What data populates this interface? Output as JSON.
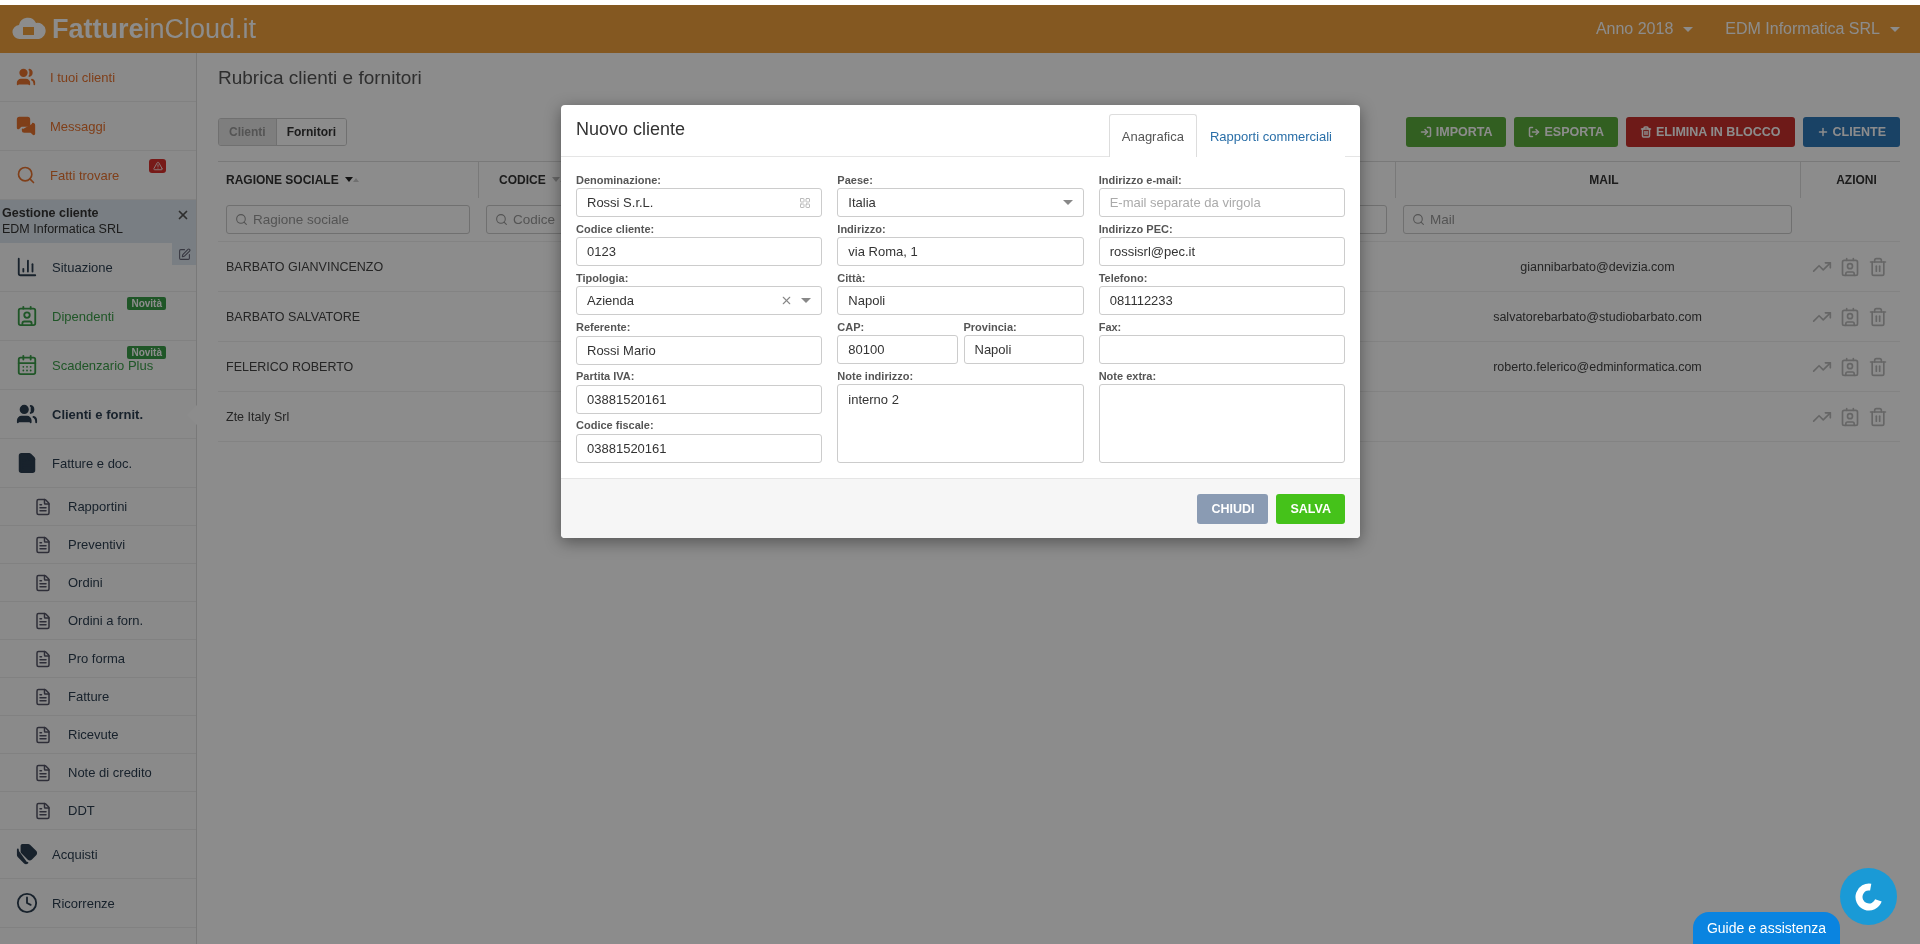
{
  "header": {
    "logo": "**Fatture**inCloud.it",
    "menus": [
      {
        "label": "Anno 2018"
      },
      {
        "label": "EDM Informatica SRL"
      }
    ]
  },
  "sidebar": {
    "top_items": [
      {
        "label": "I tuoi clienti",
        "alert": false
      },
      {
        "label": "Messaggi",
        "alert": false
      },
      {
        "label": "Fatti trovare",
        "alert": true
      }
    ],
    "client_section": {
      "title": "Gestione cliente",
      "client": "EDM Informatica SRL"
    },
    "items": [
      {
        "label": "Situazione",
        "selected": false
      },
      {
        "label": "Dipendenti",
        "badge": "Novità",
        "selected": false
      },
      {
        "label": "Scadenzario Plus",
        "badge": "Novità",
        "selected": false
      },
      {
        "label": "Clienti e fornit.",
        "selected": true
      },
      {
        "label": "Fatture e doc.",
        "selected": false,
        "children": [
          {
            "label": "Rapportini"
          },
          {
            "label": "Preventivi"
          },
          {
            "label": "Ordini"
          },
          {
            "label": "Ordini a forn."
          },
          {
            "label": "Pro forma"
          },
          {
            "label": "Fatture"
          },
          {
            "label": "Ricevute"
          },
          {
            "label": "Note di credito"
          },
          {
            "label": "DDT"
          }
        ]
      },
      {
        "label": "Acquisti",
        "selected": false
      },
      {
        "label": "Ricorrenze",
        "selected": false
      }
    ]
  },
  "main": {
    "title": "Rubrica clienti e fornitori",
    "tabs": [
      {
        "label": "Clienti",
        "selected": true
      },
      {
        "label": "Fornitori",
        "selected": false
      }
    ],
    "actions": [
      {
        "label": "IMPORTA",
        "kind": "import"
      },
      {
        "label": "ESPORTA",
        "kind": "export"
      },
      {
        "label": "ELIMINA IN BLOCCO",
        "kind": "delete"
      },
      {
        "label": "CLIENTE",
        "kind": "add"
      }
    ],
    "table": {
      "columns": [
        {
          "label": "RAGIONE SOCIALE",
          "sortable": true,
          "sorted": true,
          "filter": "Ragione sociale"
        },
        {
          "label": "CODICE",
          "sortable": true,
          "sorted": false,
          "filter": "Codice"
        },
        {
          "kind": "hidden"
        },
        {
          "label": "MAIL",
          "filter": "Mail"
        },
        {
          "label": "AZIONI"
        }
      ],
      "rows": [
        {
          "ragione_sociale": "BARBATO GIANVINCENZO",
          "mail": "giannibarbato@devizia.com"
        },
        {
          "ragione_sociale": "BARBATO SALVATORE",
          "mail": "salvatorebarbato@studiobarbato.com"
        },
        {
          "ragione_sociale": "FELERICO ROBERTO",
          "mail": "roberto.felerico@edminformatica.com"
        },
        {
          "ragione_sociale": "Zte Italy Srl"
        }
      ]
    }
  },
  "modal": {
    "title": "Nuovo cliente",
    "tabs": [
      {
        "label": "Anagrafica",
        "selected": true
      },
      {
        "label": "Rapporti commerciali",
        "selected": false
      }
    ],
    "columns": [
      [
        {
          "kind": "lookup",
          "label": "Denominazione:",
          "value": "Rossi S.r.L."
        },
        {
          "kind": "text",
          "label": "Codice cliente:",
          "value": "0123"
        },
        {
          "kind": "clearable_select",
          "label": "Tipologia:",
          "value": "Azienda"
        },
        {
          "kind": "text",
          "label": "Referente:",
          "value": "Rossi Mario"
        },
        {
          "kind": "text",
          "label": "Partita IVA:",
          "value": "03881520161"
        },
        {
          "kind": "text",
          "label": "Codice fiscale:",
          "value": "03881520161"
        }
      ],
      [
        {
          "kind": "select",
          "label": "Paese:",
          "value": "Italia"
        },
        {
          "kind": "text",
          "label": "Indirizzo:",
          "value": "via Roma, 1"
        },
        {
          "kind": "text",
          "label": "Città:",
          "value": "Napoli"
        },
        {
          "kind": "pair",
          "fields": [
            {
              "kind": "text",
              "label": "CAP:",
              "value": "80100"
            },
            {
              "kind": "text",
              "label": "Provincia:",
              "value": "Napoli"
            }
          ]
        },
        {
          "kind": "textarea",
          "label": "Note indirizzo:",
          "value": "interno 2"
        }
      ],
      [
        {
          "kind": "text",
          "label": "Indirizzo e-mail:",
          "placeholder": "E-mail separate da virgola"
        },
        {
          "kind": "text",
          "label": "Indirizzo PEC:",
          "value": "rossisrl@pec.it"
        },
        {
          "kind": "text",
          "label": "Telefono:",
          "value": "081112233"
        },
        {
          "kind": "text",
          "label": "Fax:"
        },
        {
          "kind": "textarea",
          "label": "Note extra:"
        }
      ]
    ],
    "buttons": [
      {
        "label": "CHIUDI",
        "kind": "secondary"
      },
      {
        "label": "SALVA",
        "kind": "primary"
      }
    ]
  },
  "help": {
    "label": "Guide e assistenza"
  }
}
